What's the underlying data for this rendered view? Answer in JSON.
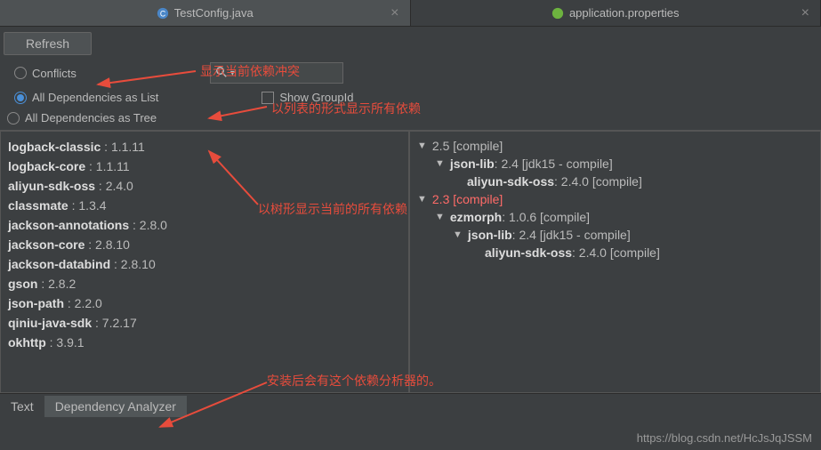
{
  "tabs": [
    {
      "label": "TestConfig.java",
      "icon": "class"
    },
    {
      "label": "application.properties",
      "icon": "spring"
    }
  ],
  "toolbar": {
    "refresh": "Refresh"
  },
  "filters": {
    "conflicts": "Conflicts",
    "asList": "All Dependencies as List",
    "asTree": "All Dependencies as Tree",
    "showGroupId": "Show GroupId"
  },
  "annotations": {
    "a1": "显示当前依赖冲突",
    "a2": "以列表的形式显示所有依赖",
    "a3": "以树形显示当前的所有依赖",
    "a4": "安装后会有这个依赖分析器的。"
  },
  "deps": [
    {
      "name": "logback-classic",
      "ver": "1.1.11"
    },
    {
      "name": "logback-core",
      "ver": "1.1.11"
    },
    {
      "name": "aliyun-sdk-oss",
      "ver": "2.4.0"
    },
    {
      "name": "classmate",
      "ver": "1.3.4"
    },
    {
      "name": "jackson-annotations",
      "ver": "2.8.0"
    },
    {
      "name": "jackson-core",
      "ver": "2.8.10"
    },
    {
      "name": "jackson-databind",
      "ver": "2.8.10"
    },
    {
      "name": "gson",
      "ver": "2.8.2"
    },
    {
      "name": "json-path",
      "ver": "2.2.0"
    },
    {
      "name": "qiniu-java-sdk",
      "ver": "7.2.17"
    },
    {
      "name": "okhttp",
      "ver": "3.9.1"
    }
  ],
  "tree": {
    "n0": "2.5 [compile]",
    "n1": "json-lib",
    "n1v": " : 2.4 [jdk15 - compile]",
    "n2": "aliyun-sdk-oss",
    "n2v": " : 2.4.0 [compile]",
    "n3": "2.3 [compile]",
    "n4": "ezmorph",
    "n4v": " : 1.0.6 [compile]",
    "n5": "json-lib",
    "n5v": " : 2.4 [jdk15 - compile]",
    "n6": "aliyun-sdk-oss",
    "n6v": " : 2.4.0 [compile]"
  },
  "bottomTabs": {
    "text": "Text",
    "analyzer": "Dependency Analyzer"
  },
  "watermark": "https://blog.csdn.net/HcJsJqJSSM"
}
